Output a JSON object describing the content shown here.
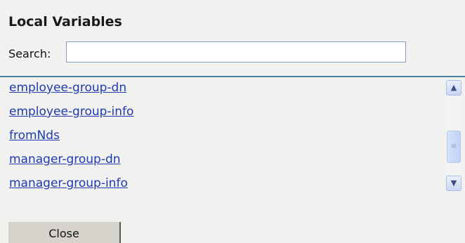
{
  "dialog": {
    "title": "Local Variables",
    "search_label": "Search:",
    "search_value": "",
    "items": [
      {
        "label": "employee-group-dn"
      },
      {
        "label": "employee-group-info"
      },
      {
        "label": "fromNds"
      },
      {
        "label": "manager-group-dn"
      },
      {
        "label": "manager-group-info"
      }
    ],
    "close_label": "Close"
  },
  "icons": {
    "scroll_up": "▲",
    "scroll_down": "▼",
    "thumb_grip": "≡"
  },
  "colors": {
    "link": "#1f3ab0",
    "separator": "#4f7fa8",
    "background": "#f1f1ef"
  }
}
